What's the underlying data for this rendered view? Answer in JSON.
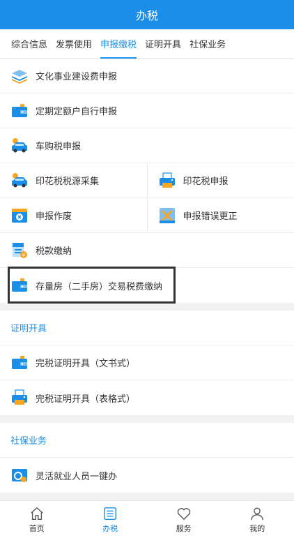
{
  "header": {
    "title": "办税"
  },
  "tabs": [
    {
      "label": "综合信息",
      "active": false
    },
    {
      "label": "发票使用",
      "active": false
    },
    {
      "label": "申报缴税",
      "active": true
    },
    {
      "label": "证明开具",
      "active": false
    },
    {
      "label": "社保业务",
      "active": false
    }
  ],
  "declare": {
    "items": [
      {
        "label": "文化事业建设费申报",
        "icon": "layers-icon"
      },
      {
        "label": "定期定额户自行申报",
        "icon": "wallet-icon"
      },
      {
        "label": "车购税申报",
        "icon": "car-icon"
      },
      {
        "label": "印花税税源采集",
        "icon": "car-icon"
      },
      {
        "label": "印花税申报",
        "icon": "printer-icon"
      },
      {
        "label": "申报作废",
        "icon": "cancel-doc-icon"
      },
      {
        "label": "申报错误更正",
        "icon": "correction-icon"
      },
      {
        "label": "税款缴纳",
        "icon": "tax-payment-icon"
      },
      {
        "label": "存量房（二手房）交易税费缴纳",
        "icon": "wallet-icon"
      }
    ]
  },
  "certificate": {
    "title": "证明开具",
    "items": [
      {
        "label": "完税证明开具（文书式）",
        "icon": "wallet-icon"
      },
      {
        "label": "完税证明开具（表格式）",
        "icon": "printer-icon"
      }
    ]
  },
  "social": {
    "title": "社保业务",
    "items": [
      {
        "label": "灵活就业人员一键办",
        "icon": "social-card-icon"
      }
    ]
  },
  "bottom_nav": [
    {
      "label": "首页",
      "icon": "home-icon",
      "active": false
    },
    {
      "label": "办税",
      "icon": "list-icon",
      "active": true
    },
    {
      "label": "服务",
      "icon": "heart-icon",
      "active": false
    },
    {
      "label": "我的",
      "icon": "user-icon",
      "active": false
    }
  ],
  "colors": {
    "primary": "#1a8ee8",
    "orange": "#f5a623",
    "background": "#f2f2f2"
  }
}
